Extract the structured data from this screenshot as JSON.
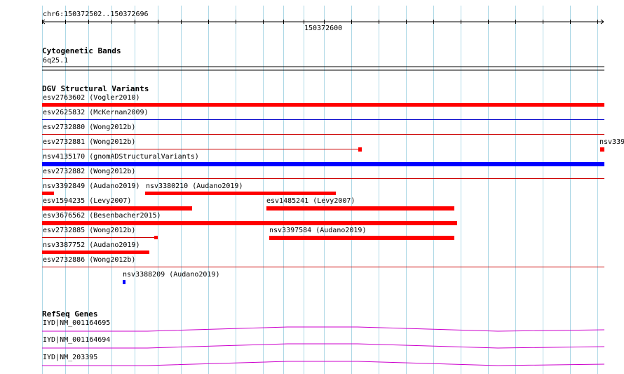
{
  "location": "chr6:150372502..150372696",
  "ruler": {
    "tick_label": "150372600"
  },
  "tracks": {
    "cytoband": {
      "title": "Cytogenetic Bands",
      "band": "6q25.1"
    },
    "dgv": {
      "title": "DGV Structural Variants",
      "features": [
        {
          "label": "esv2763602 (Vogler2010)",
          "color": "#ff0000",
          "kind": "bar"
        },
        {
          "label": "esv2625832 (McKernan2009)",
          "color": "#0000cc",
          "kind": "line"
        },
        {
          "label": "esv2732880 (Wong2012b)",
          "color": "#cc0000",
          "kind": "line"
        },
        {
          "label": "esv2732881 (Wong2012b)",
          "color": "#cc0000",
          "kind": "line-with-end"
        },
        {
          "label": "nsv339",
          "color": "#ff0000",
          "kind": "small-block"
        },
        {
          "label": "nsv4135170 (gnomADStructuralVariants)",
          "color": "#0000ff",
          "kind": "bar"
        },
        {
          "label": "esv2732882 (Wong2012b)",
          "color": "#cc0000",
          "kind": "line"
        },
        {
          "label": "nsv3392849 (Audano2019)",
          "color": "#ff0000",
          "kind": "short-bar"
        },
        {
          "label": "nsv3380210 (Audano2019)",
          "color": "#ff0000",
          "kind": "bar"
        },
        {
          "label": "esv1594235 (Levy2007)",
          "color": "#ff0000",
          "kind": "bar"
        },
        {
          "label": "esv1485241 (Levy2007)",
          "color": "#ff0000",
          "kind": "bar"
        },
        {
          "label": "esv3676562 (Besenbacher2015)",
          "color": "#ff0000",
          "kind": "bar"
        },
        {
          "label": "esv2732885 (Wong2012b)",
          "color": "#cc0000",
          "kind": "line-with-end"
        },
        {
          "label": "nsv3397584 (Audano2019)",
          "color": "#ff0000",
          "kind": "bar"
        },
        {
          "label": "nsv3387752 (Audano2019)",
          "color": "#ff0000",
          "kind": "bar"
        },
        {
          "label": "esv2732886 (Wong2012b)",
          "color": "#cc0000",
          "kind": "line"
        },
        {
          "label": "nsv3388209 (Audano2019)",
          "color": "#0000ff",
          "kind": "small-block"
        }
      ]
    },
    "refseq": {
      "title": "RefSeq Genes",
      "color": "#cc00cc",
      "genes": [
        {
          "label": "IYD|NM_001164695"
        },
        {
          "label": "IYD|NM_001164694"
        },
        {
          "label": "IYD|NM_203395"
        }
      ]
    }
  },
  "colors": {
    "grid": "#add8e6",
    "axis": "#000000"
  }
}
